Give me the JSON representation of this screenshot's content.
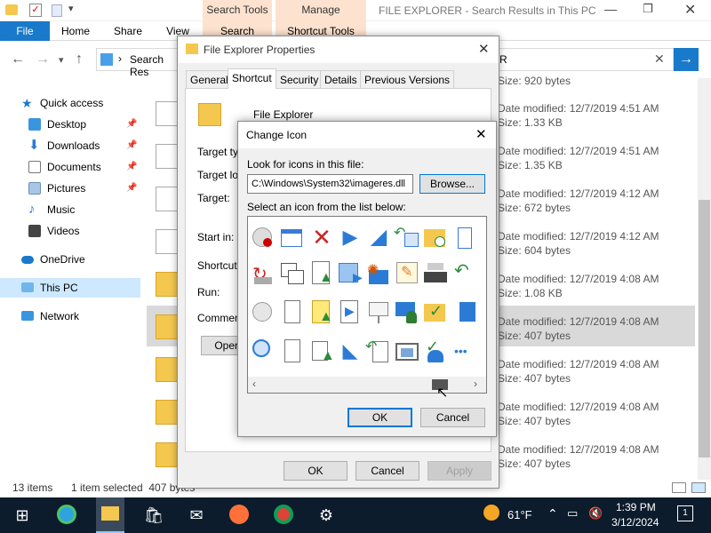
{
  "explorer": {
    "window_title": "FILE EXPLORER - Search Results in This PC",
    "ribbon_tabs": {
      "file": "File",
      "home": "Home",
      "share": "Share",
      "view": "View"
    },
    "context_tabs": [
      {
        "group": "Search Tools",
        "label": "Search"
      },
      {
        "group": "Manage",
        "label": "Shortcut Tools"
      }
    ],
    "address_text": "Search Res",
    "search_text": "R",
    "nav": [
      {
        "label": "Quick access"
      },
      {
        "label": "Desktop"
      },
      {
        "label": "Downloads"
      },
      {
        "label": "Documents"
      },
      {
        "label": "Pictures"
      },
      {
        "label": "Music"
      },
      {
        "label": "Videos"
      },
      {
        "label": "OneDrive"
      },
      {
        "label": "This PC"
      },
      {
        "label": "Network"
      }
    ],
    "rows": [
      {
        "size": "Size: 920 bytes"
      },
      {
        "date": "Date modified: 12/7/2019 4:51 AM",
        "size": "Size: 1.33 KB"
      },
      {
        "date": "Date modified: 12/7/2019 4:51 AM",
        "size": "Size: 1.35 KB"
      },
      {
        "date": "Date modified: 12/7/2019 4:12 AM",
        "size": "Size: 672 bytes"
      },
      {
        "date": "Date modified: 12/7/2019 4:12 AM",
        "size": "Size: 604 bytes"
      },
      {
        "date": "Date modified: 12/7/2019 4:08 AM",
        "size": "Size: 1.08 KB"
      },
      {
        "date": "Date modified: 12/7/2019 4:08 AM",
        "size": "Size: 407 bytes"
      },
      {
        "date": "Date modified: 12/7/2019 4:08 AM",
        "size": "Size: 407 bytes"
      },
      {
        "date": "Date modified: 12/7/2019 4:08 AM",
        "size": "Size: 407 bytes"
      },
      {
        "date": "Date modified: 12/7/2019 4:08 AM",
        "size": "Size: 407 bytes"
      }
    ],
    "status": {
      "count": "13 items",
      "selected": "1 item selected  407 bytes"
    }
  },
  "props": {
    "title": "File Explorer Properties",
    "tabs": [
      "General",
      "Shortcut",
      "Security",
      "Details",
      "Previous Versions"
    ],
    "name": "File Explorer",
    "labels": {
      "target_type": "Target typ",
      "target_loc": "Target loc",
      "target": "Target:",
      "start_in": "Start in:",
      "shortcut_key": "Shortcut k",
      "run": "Run:",
      "comment": "Comment:"
    },
    "open_btn": "Open",
    "ok": "OK",
    "cancel": "Cancel",
    "apply": "Apply"
  },
  "change_icon": {
    "title": "Change Icon",
    "look_label": "Look for icons in this file:",
    "path": "C:\\Windows\\System32\\imageres.dll",
    "browse": "Browse...",
    "select_label": "Select an icon from the list below:",
    "ok": "OK",
    "cancel": "Cancel"
  },
  "taskbar": {
    "weather_temp": "61°F",
    "time": "1:39 PM",
    "date": "3/12/2024",
    "notif_count": "1"
  },
  "colors": {
    "accent": "#1979ca",
    "context_tab": "#fde3cf",
    "taskbar": "#0c1c2c",
    "default_button": "#0078d7"
  }
}
